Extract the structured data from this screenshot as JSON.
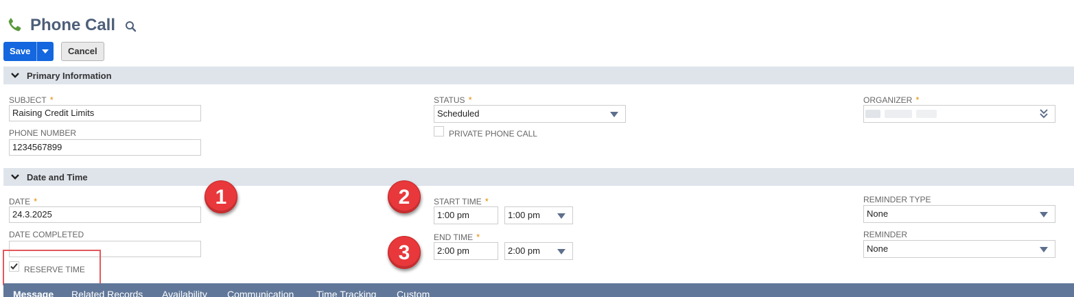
{
  "header": {
    "title": "Phone Call"
  },
  "toolbar": {
    "save_label": "Save",
    "cancel_label": "Cancel"
  },
  "sections": {
    "primary": "Primary Information",
    "datetime": "Date and Time"
  },
  "primary": {
    "subject": {
      "label": "SUBJECT",
      "required": "*",
      "value": "Raising Credit Limits"
    },
    "phone": {
      "label": "PHONE NUMBER",
      "value": "1234567899"
    },
    "status": {
      "label": "STATUS",
      "required": "*",
      "value": "Scheduled"
    },
    "private": {
      "label": "PRIVATE PHONE CALL",
      "checked": false
    },
    "organizer": {
      "label": "ORGANIZER",
      "required": "*",
      "value": ""
    }
  },
  "datetime": {
    "date": {
      "label": "DATE",
      "required": "*",
      "value": "24.3.2025"
    },
    "date_completed": {
      "label": "DATE COMPLETED",
      "value": ""
    },
    "reserve_time": {
      "label": "RESERVE TIME",
      "checked": true
    },
    "start_time": {
      "label": "START TIME",
      "required": "*",
      "value": "1:00 pm",
      "select": "1:00 pm"
    },
    "end_time": {
      "label": "END TIME",
      "required": "*",
      "value": "2:00 pm",
      "select": "2:00 pm"
    },
    "reminder_type": {
      "label": "REMINDER TYPE",
      "value": "None"
    },
    "reminder": {
      "label": "REMINDER",
      "value": "None"
    }
  },
  "badges": [
    "1",
    "2",
    "3"
  ],
  "tabs": [
    "Message",
    "Related Records",
    "Availability",
    "Communication",
    "Time Tracking",
    "Custom"
  ],
  "colors": {
    "accent": "#1467de",
    "section_bg": "#dfe4eb",
    "tabbar_bg": "#607799",
    "badge": "#e8383b",
    "required": "#e08a00"
  }
}
